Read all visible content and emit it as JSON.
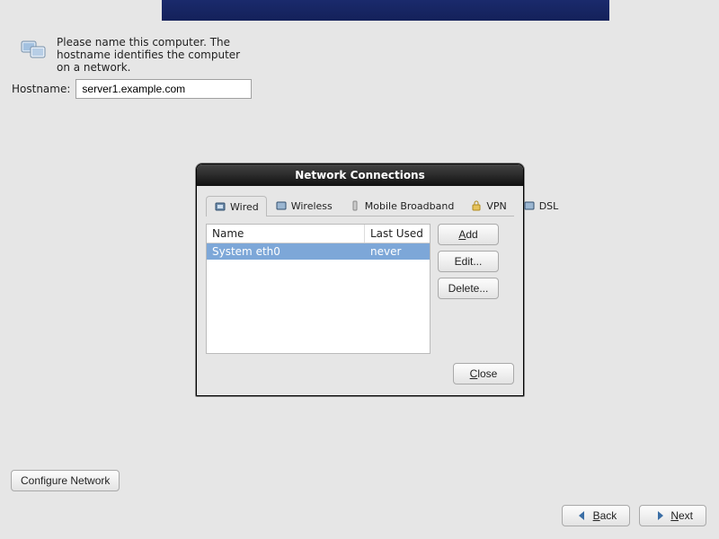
{
  "intro": {
    "text": "Please name this computer.  The hostname identifies the computer on a network."
  },
  "hostname": {
    "label": "Hostname:",
    "value": "server1.example.com"
  },
  "configure_label": "Configure Network",
  "nav": {
    "back": "Back",
    "next": "Next"
  },
  "dialog": {
    "title": "Network Connections",
    "tabs": [
      {
        "label": "Wired",
        "icon": "wired"
      },
      {
        "label": "Wireless",
        "icon": "wireless"
      },
      {
        "label": "Mobile Broadband",
        "icon": "mobile"
      },
      {
        "label": "VPN",
        "icon": "vpn"
      },
      {
        "label": "DSL",
        "icon": "dsl"
      }
    ],
    "columns": {
      "name": "Name",
      "last": "Last Used"
    },
    "rows": [
      {
        "name": "System eth0",
        "last": "never",
        "selected": true
      }
    ],
    "buttons": {
      "add": "Add",
      "edit": "Edit...",
      "delete": "Delete...",
      "close": "Close"
    }
  }
}
